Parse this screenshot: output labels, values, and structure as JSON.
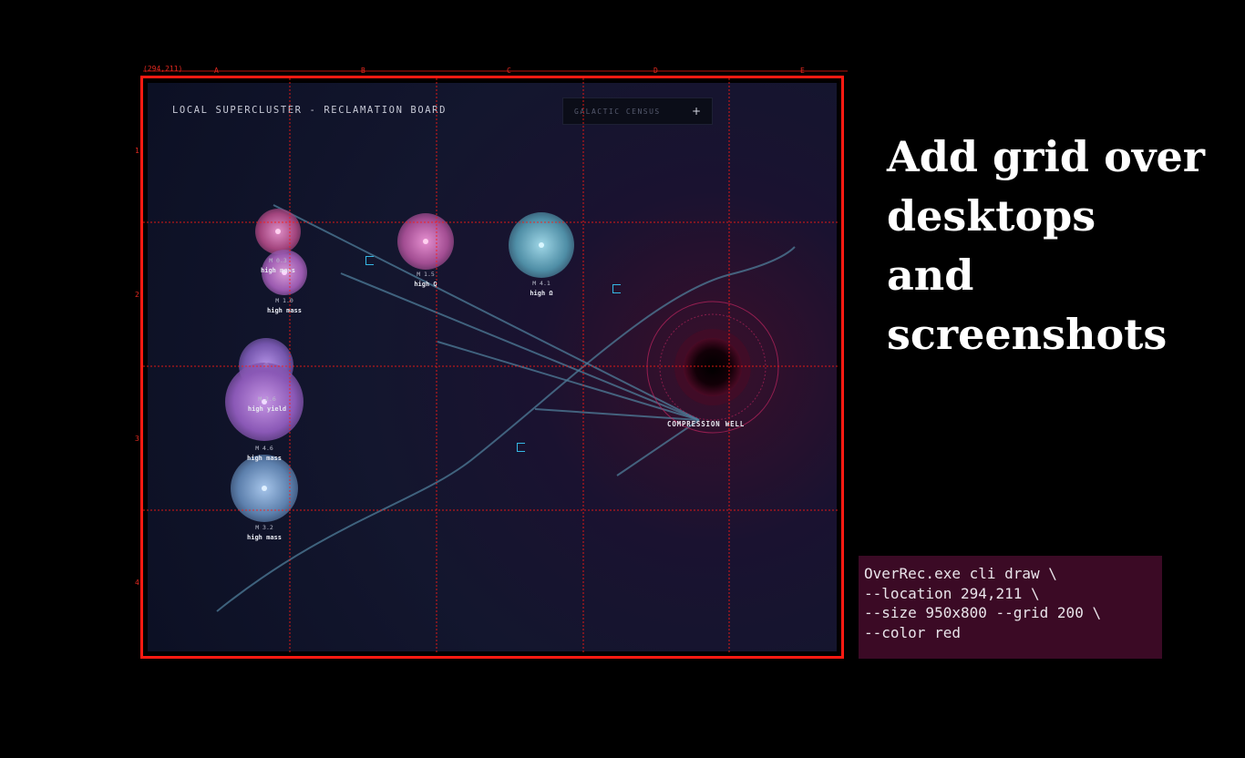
{
  "overlay": {
    "location_label": "(294,211)",
    "column_labels": [
      "A",
      "B",
      "C",
      "D",
      "E"
    ],
    "row_labels": [
      "1",
      "2",
      "3",
      "4"
    ],
    "grid_color": "#ff1a12"
  },
  "board": {
    "title": "LOCAL SUPERCLUSTER - RECLAMATION BOARD",
    "census_button_label": "GALACTIC CENSUS",
    "census_button_icon": "+",
    "bodies": [
      {
        "mass": "M 0.3",
        "tag": "high mass",
        "color": "#d874b8"
      },
      {
        "mass": "M 1.0",
        "tag": "high mass",
        "color": "#c77bc9"
      },
      {
        "mass": "M 1.5",
        "tag": "high Q",
        "color": "#d06ab8"
      },
      {
        "mass": "M 4.1",
        "tag": "high Ω",
        "color": "#6fb3c8"
      },
      {
        "mass": "M 2.6",
        "tag": "high yield",
        "color": "#9a73d0"
      },
      {
        "mass": "M 4.6",
        "tag": "high mass",
        "color": "#a776cf"
      },
      {
        "mass": "M 3.2",
        "tag": "high mass",
        "color": "#7ea7d4"
      }
    ],
    "well_label": "COMPRESSION WELL",
    "accent_colors": {
      "marker": "#35b8e6",
      "well": "#c0255f",
      "trajectory": "#4f7d99"
    }
  },
  "headline": {
    "lines": [
      "Add grid over",
      "desktops",
      "and",
      "screenshots"
    ]
  },
  "cli": {
    "lines": [
      "OverRec.exe cli draw \\",
      "--location 294,211 \\",
      "--size 950x800 --grid 200 \\",
      "--color red"
    ]
  }
}
